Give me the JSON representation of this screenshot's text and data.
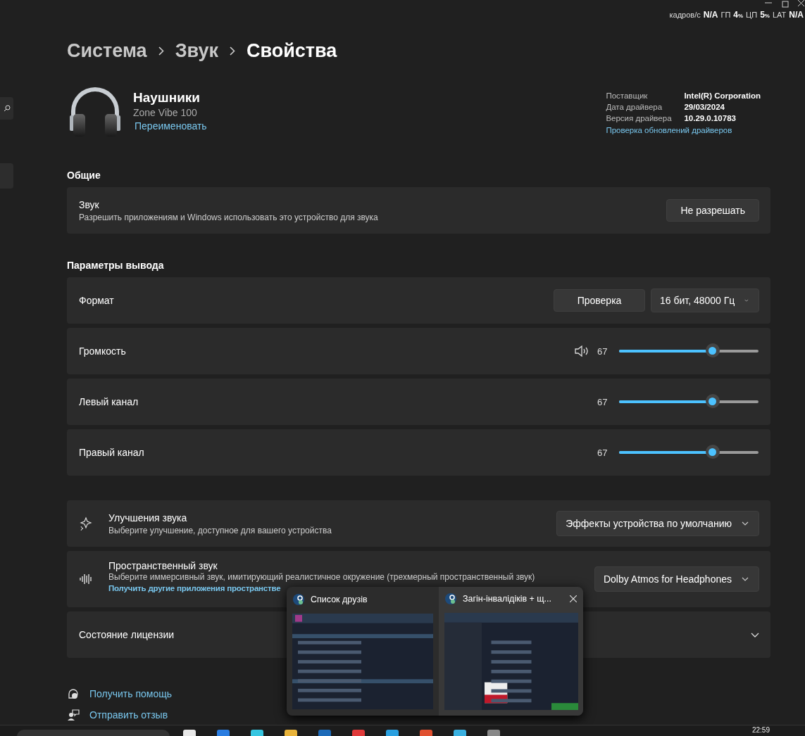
{
  "perf_overlay": [
    {
      "label": "кадров/с",
      "value": "N/A"
    },
    {
      "label": "ГП",
      "value": "4",
      "unit": "%"
    },
    {
      "label": "ЦП",
      "value": "5",
      "unit": "%"
    },
    {
      "label": "LAT",
      "value": "N/A"
    }
  ],
  "breadcrumb": [
    "Система",
    "Звук",
    "Свойства"
  ],
  "device": {
    "name": "Наушники",
    "model": "Zone Vibe 100",
    "rename_link": "Переименовать"
  },
  "driver_info": {
    "rows": [
      {
        "label": "Поставщик",
        "value": "Intel(R) Corporation"
      },
      {
        "label": "Дата драйвера",
        "value": "29/03/2024"
      },
      {
        "label": "Версия драйвера",
        "value": "10.29.0.10783"
      }
    ],
    "link": "Проверка обновлений драйверов"
  },
  "general": {
    "title": "Общие",
    "card": {
      "title": "Звук",
      "description": "Разрешить приложениям и Windows использовать это устройство для звука",
      "button": "Не разрешать"
    }
  },
  "output": {
    "title": "Параметры вывода",
    "rows": [
      {
        "kind": "format",
        "label": "Формат",
        "button": "Проверка",
        "dropdown": "16 бит, 48000 Гц"
      },
      {
        "kind": "slider",
        "label": "Громкость",
        "speaker_icon": true,
        "value": "67",
        "level": 0.67
      },
      {
        "kind": "slider",
        "label": "Левый канал",
        "speaker_icon": false,
        "value": "67",
        "level": 0.67
      },
      {
        "kind": "slider",
        "label": "Правый канал",
        "speaker_icon": false,
        "value": "67",
        "level": 0.67
      }
    ]
  },
  "more": [
    {
      "kind": "enhancements",
      "title": "Улучшения звука",
      "description": "Выберите улучшение, доступное для вашего устройства",
      "dropdown": "Эффекты устройства по умолчанию"
    },
    {
      "kind": "spatial",
      "title": "Пространственный звук",
      "description": "Выберите иммерсивный звук, имитирующий реалистичное окружение (трехмерный пространственный звук)",
      "link": "Получить другие приложения пространстве",
      "dropdown": "Dolby Atmos for Headphones"
    },
    {
      "kind": "expander",
      "title": "Состояние лицензии",
      "expanded": false
    }
  ],
  "footer_links": [
    {
      "kind": "help",
      "label": "Получить помощь"
    },
    {
      "kind": "feedback",
      "label": "Отправить отзыв"
    }
  ],
  "taskbar_popup": {
    "windows": [
      {
        "title": "Список друзів",
        "selected": false,
        "close": false
      },
      {
        "title": "Загін-інвалідіків + щ...",
        "selected": true,
        "close": true
      }
    ]
  },
  "taskbar": {
    "clock": "22:59"
  }
}
